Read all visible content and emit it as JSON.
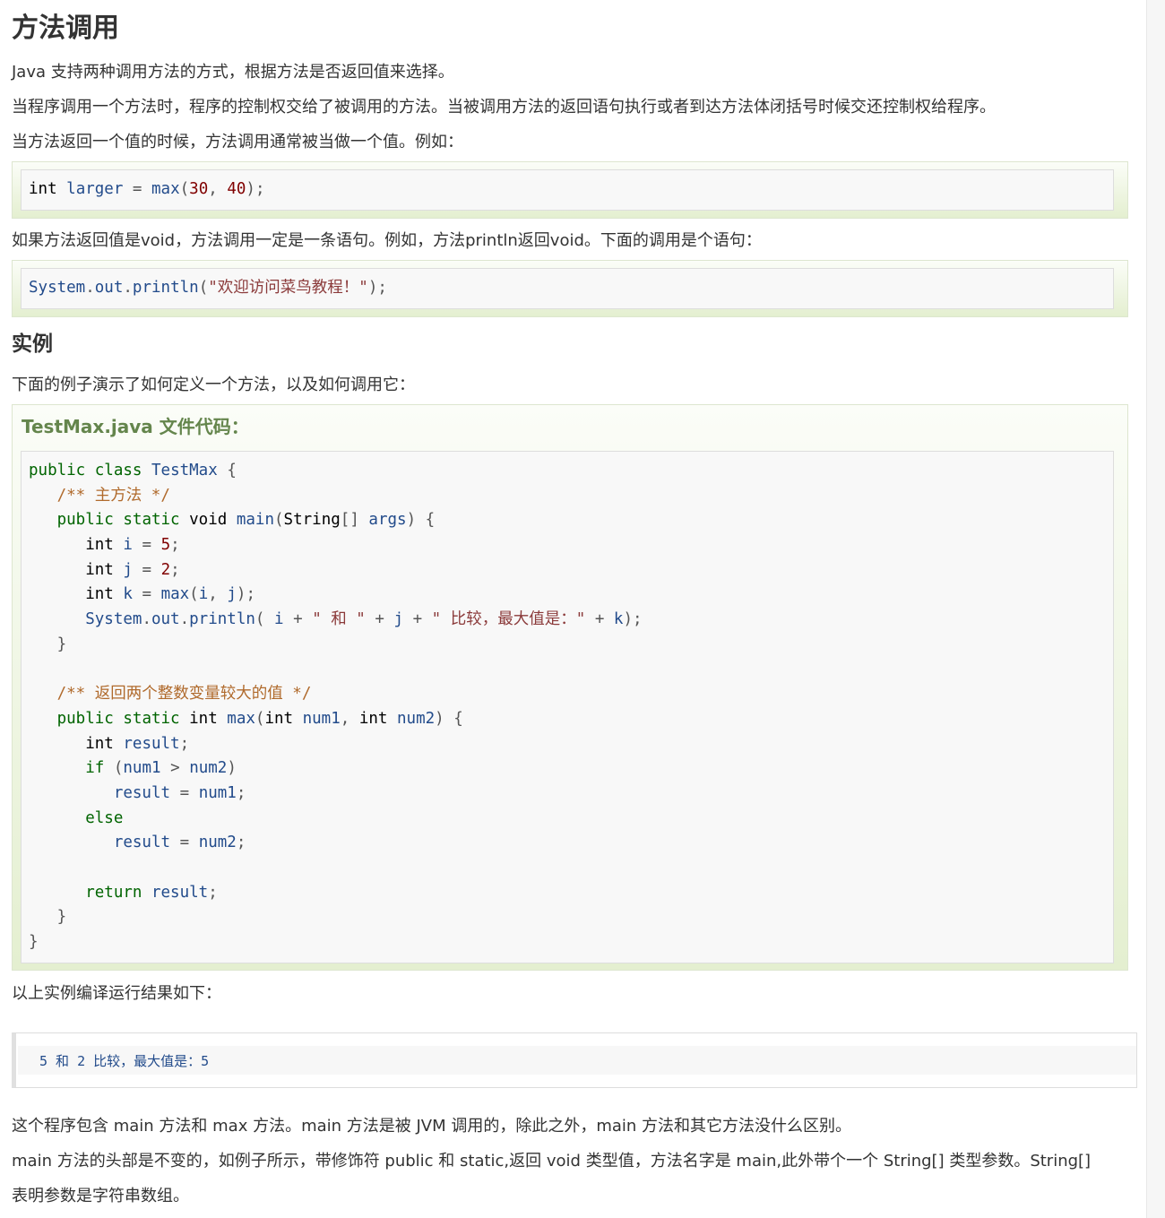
{
  "heading": "方法调用",
  "intro": [
    "Java 支持两种调用方法的方式，根据方法是否返回值来选择。",
    "当程序调用一个方法时，程序的控制权交给了被调用的方法。当被调用方法的返回语句执行或者到达方法体闭括号时候交还控制权给程序。",
    "当方法返回一个值的时候，方法调用通常被当做一个值。例如："
  ],
  "snippet1": [
    "int",
    "larger",
    "=",
    "max",
    "(",
    "30",
    ",",
    "40",
    ");"
  ],
  "void_note": "如果方法返回值是void，方法调用一定是一条语句。例如，方法println返回void。下面的调用是个语句：",
  "snippet2": [
    "System",
    ".",
    "out",
    ".",
    "println",
    "(",
    "\"欢迎访问菜鸟教程！\"",
    ");"
  ],
  "example_heading": "实例",
  "example_intro": "下面的例子演示了如何定义一个方法，以及如何调用它：",
  "example_title": "TestMax.java 文件代码：",
  "code_lines": [
    "public class TestMax {",
    "   /** 主方法 */",
    "   public static void main(String[] args) {",
    "      int i = 5;",
    "      int j = 2;",
    "      int k = max(i, j);",
    "      System.out.println( i + \" 和 \" + j + \" 比较，最大值是：\" + k);",
    "   }",
    "",
    "   /** 返回两个整数变量较大的值 */",
    "   public static int max(int num1, int num2) {",
    "      int result;",
    "      if (num1 > num2)",
    "         result = num1;",
    "      else",
    "         result = num2;",
    "",
    "      return result;",
    "   }",
    "}"
  ],
  "result_intro": "以上实例编译运行结果如下：",
  "output": "5 和 2 比较，最大值是：5",
  "closing": [
    "这个程序包含 main 方法和 max 方法。main 方法是被 JVM 调用的，除此之外，main 方法和其它方法没什么区别。",
    "main 方法的头部是不变的，如例子所示，带修饰符 public 和 static,返回 void 类型值，方法名字是 main,此外带个一个 String[] 类型参数。String[]",
    "表明参数是字符串数组。"
  ]
}
